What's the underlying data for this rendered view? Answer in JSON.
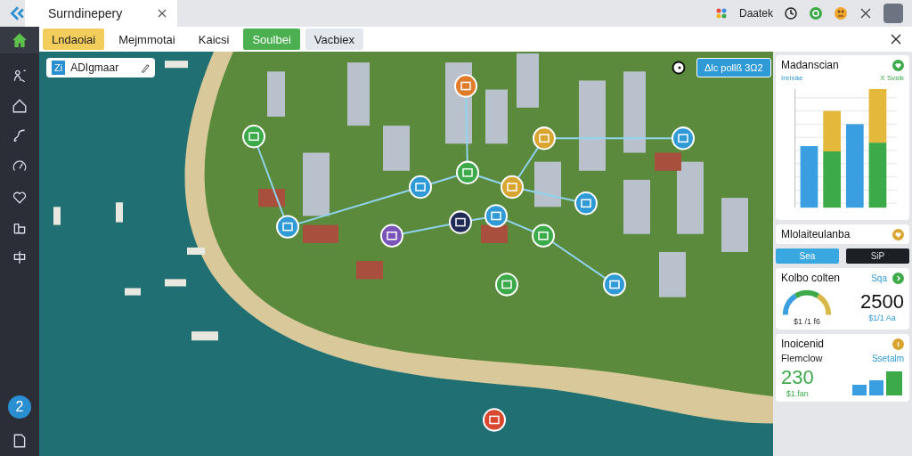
{
  "window": {
    "title": "Surndinepery",
    "user_label": "Daatek"
  },
  "toolbar": {
    "tabs": [
      {
        "label": "Lndaoiai",
        "selected": false,
        "color": "#f2cd5c"
      },
      {
        "label": "Mejmmotai",
        "selected": false,
        "color": "#ffffff"
      },
      {
        "label": "Kaicsi",
        "selected": false,
        "color": "#ffffff"
      },
      {
        "label": "Soulbei",
        "selected": true,
        "color": "#4caf50"
      },
      {
        "label": "Vacbiex",
        "selected": false,
        "color": "#e3e7ee"
      }
    ]
  },
  "sidebar": {
    "badge": "2"
  },
  "map": {
    "layer_card": {
      "icon_text": "Zi",
      "title": "ADIgmaar"
    },
    "callout": "Δlc pollß 3Ω2"
  },
  "panel": {
    "chart_card": {
      "title": "Madanscian",
      "legend": [
        "Ireíxáe",
        "X Svsik"
      ]
    },
    "second_card": {
      "title": "Mlolaiteulanba"
    },
    "buttons": [
      {
        "label": "Sea",
        "selected": true
      },
      {
        "label": "SiP",
        "selected": false
      }
    ],
    "gauge_card": {
      "title": "Kolbo colten",
      "link": "Sqa",
      "value": "2500",
      "gauge_caption": "$1 /1 f6",
      "value_caption": "$1/1 Aa"
    },
    "income_card": {
      "title": "Inoicenid",
      "subtitle": "Flemclow",
      "link": "Ssetalm",
      "value": "230",
      "value_caption": "$1.fan"
    }
  }
}
